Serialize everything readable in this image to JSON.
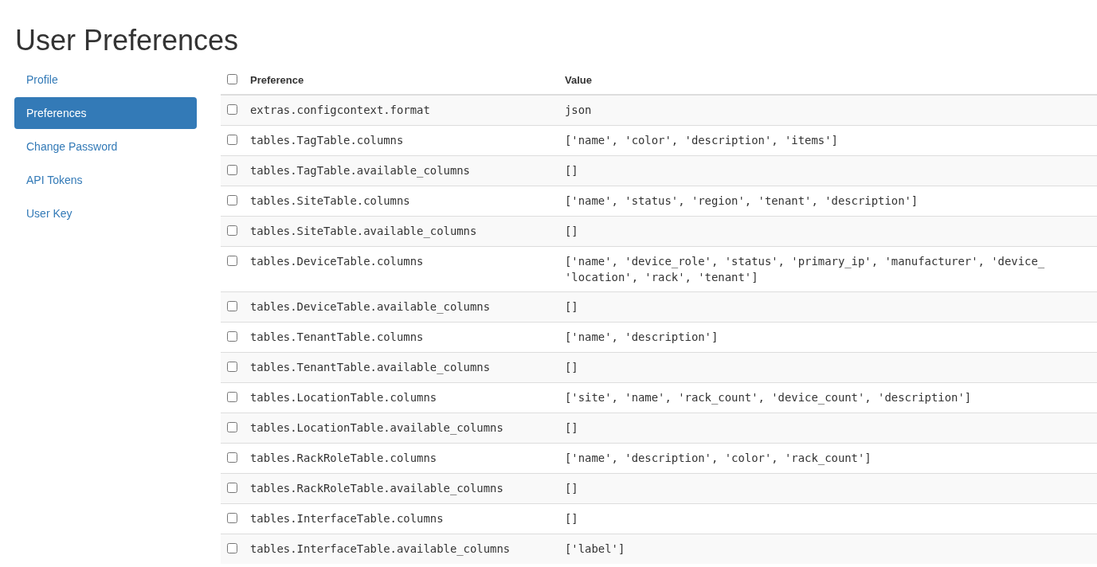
{
  "page_title": "User Preferences",
  "sidebar": {
    "items": [
      {
        "label": "Profile",
        "selected": false
      },
      {
        "label": "Preferences",
        "selected": true
      },
      {
        "label": "Change Password",
        "selected": false
      },
      {
        "label": "API Tokens",
        "selected": false
      },
      {
        "label": "User Key",
        "selected": false
      }
    ]
  },
  "table": {
    "select_all": {
      "checked": false
    },
    "columns": [
      "Preference",
      "Value"
    ],
    "rows": [
      {
        "checked": false,
        "preference": "extras.configcontext.format",
        "value": "json"
      },
      {
        "checked": false,
        "preference": "tables.TagTable.columns",
        "value": "['name', 'color', 'description', 'items']"
      },
      {
        "checked": false,
        "preference": "tables.TagTable.available_columns",
        "value": "[]"
      },
      {
        "checked": false,
        "preference": "tables.SiteTable.columns",
        "value": "['name', 'status', 'region', 'tenant', 'description']"
      },
      {
        "checked": false,
        "preference": "tables.SiteTable.available_columns",
        "value": "[]"
      },
      {
        "checked": false,
        "preference": "tables.DeviceTable.columns",
        "value": "['name', 'device_role', 'status', 'primary_ip', 'manufacturer', 'device_\n'location', 'rack', 'tenant']"
      },
      {
        "checked": false,
        "preference": "tables.DeviceTable.available_columns",
        "value": "[]"
      },
      {
        "checked": false,
        "preference": "tables.TenantTable.columns",
        "value": "['name', 'description']"
      },
      {
        "checked": false,
        "preference": "tables.TenantTable.available_columns",
        "value": "[]"
      },
      {
        "checked": false,
        "preference": "tables.LocationTable.columns",
        "value": "['site', 'name', 'rack_count', 'device_count', 'description']"
      },
      {
        "checked": false,
        "preference": "tables.LocationTable.available_columns",
        "value": "[]"
      },
      {
        "checked": false,
        "preference": "tables.RackRoleTable.columns",
        "value": "['name', 'description', 'color', 'rack_count']"
      },
      {
        "checked": false,
        "preference": "tables.RackRoleTable.available_columns",
        "value": "[]"
      },
      {
        "checked": false,
        "preference": "tables.InterfaceTable.columns",
        "value": "[]"
      },
      {
        "checked": false,
        "preference": "tables.InterfaceTable.available_columns",
        "value": "['label']"
      }
    ]
  }
}
